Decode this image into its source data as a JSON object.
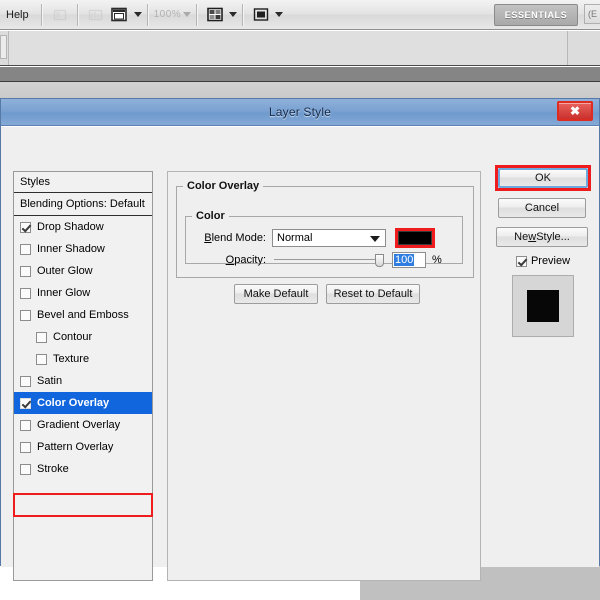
{
  "app": {
    "menu": {
      "help_label": "Help"
    },
    "toolbar": {
      "icons": [
        {
          "name": "screen-mode-disabled-icon",
          "glyph": "▤",
          "disabled": true
        },
        {
          "name": "bridge-disabled-icon",
          "glyph": "▦",
          "disabled": true
        },
        {
          "name": "arrange-documents-icon",
          "glyph": "▣",
          "disabled": false
        },
        {
          "name": "zoom-level-disabled-label",
          "glyph": "100%",
          "disabled": true
        },
        {
          "name": "grid-layout-icon",
          "glyph": "▦",
          "disabled": false
        },
        {
          "name": "screen-mode-icon",
          "glyph": "■",
          "disabled": false
        }
      ],
      "workspace_label": "ESSENTIALS",
      "workspace_overflow_label": "(E"
    }
  },
  "dialog": {
    "title": "Layer Style",
    "close_label": "✖",
    "styles": {
      "header_label": "Styles",
      "blending_options_label": "Blending Options: Default",
      "items": [
        {
          "label": "Drop Shadow",
          "checked": true,
          "sub": false,
          "selected": false
        },
        {
          "label": "Inner Shadow",
          "checked": false,
          "sub": false,
          "selected": false
        },
        {
          "label": "Outer Glow",
          "checked": false,
          "sub": false,
          "selected": false
        },
        {
          "label": "Inner Glow",
          "checked": false,
          "sub": false,
          "selected": false
        },
        {
          "label": "Bevel and Emboss",
          "checked": false,
          "sub": false,
          "selected": false
        },
        {
          "label": "Contour",
          "checked": false,
          "sub": true,
          "selected": false
        },
        {
          "label": "Texture",
          "checked": false,
          "sub": true,
          "selected": false
        },
        {
          "label": "Satin",
          "checked": false,
          "sub": false,
          "selected": false
        },
        {
          "label": "Color Overlay",
          "checked": true,
          "sub": false,
          "selected": true
        },
        {
          "label": "Gradient Overlay",
          "checked": false,
          "sub": false,
          "selected": false
        },
        {
          "label": "Pattern Overlay",
          "checked": false,
          "sub": false,
          "selected": false
        },
        {
          "label": "Stroke",
          "checked": false,
          "sub": false,
          "selected": false
        }
      ]
    },
    "settings": {
      "group_title": "Color Overlay",
      "color_group_title": "Color",
      "blend_mode_label": "Blend Mode:",
      "blend_mode_value": "Normal",
      "color_swatch_hex": "#000000",
      "opacity_label": "Opacity:",
      "opacity_value": "100",
      "opacity_unit": "%",
      "make_default_label": "Make Default",
      "reset_default_label": "Reset to Default"
    },
    "actions": {
      "ok_label": "OK",
      "cancel_label": "Cancel",
      "new_style_label": "New Style...",
      "preview_label": "Preview",
      "preview_checked": true,
      "preview_swatch_hex": "#070707"
    },
    "highlight_color": "#ee1c1c"
  }
}
